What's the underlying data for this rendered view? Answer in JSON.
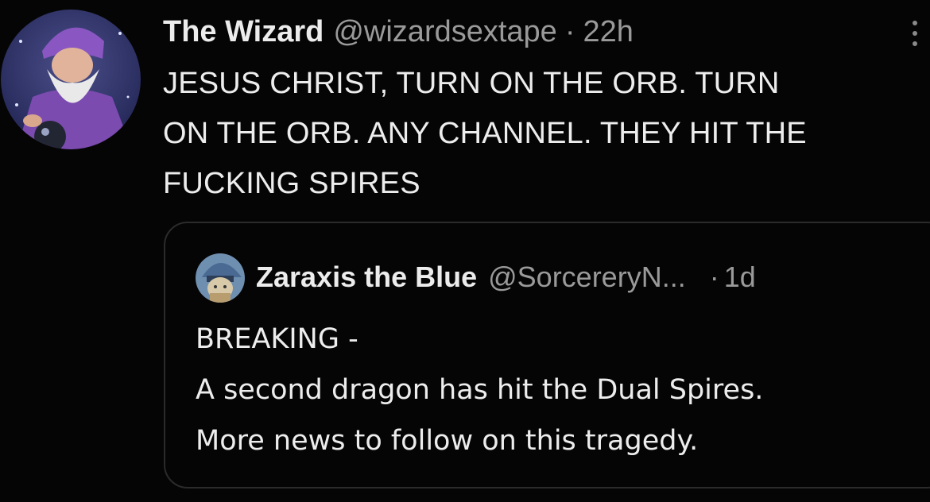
{
  "tweet": {
    "display_name": "The Wizard",
    "handle": "@wizardsextape",
    "separator": "·",
    "time": "22h",
    "text": "JESUS CHRIST, TURN ON THE ORB. TURN\nON THE ORB. ANY CHANNEL. THEY HIT THE\nFUCKING SPIRES"
  },
  "quoted_tweet": {
    "display_name": "Zaraxis the Blue",
    "handle": "@SorcereryN...",
    "separator": "·",
    "time": "1d",
    "text": "BREAKING -\nA second dragon has hit the Dual Spires.\nMore news to follow on this tragedy."
  },
  "icons": {
    "more": "more-vertical-icon"
  },
  "colors": {
    "background": "#050505",
    "text_primary": "#ededed",
    "text_secondary": "#9a9a9a",
    "border": "#2b2b2b",
    "avatar_accent": "#7b4bb0"
  }
}
